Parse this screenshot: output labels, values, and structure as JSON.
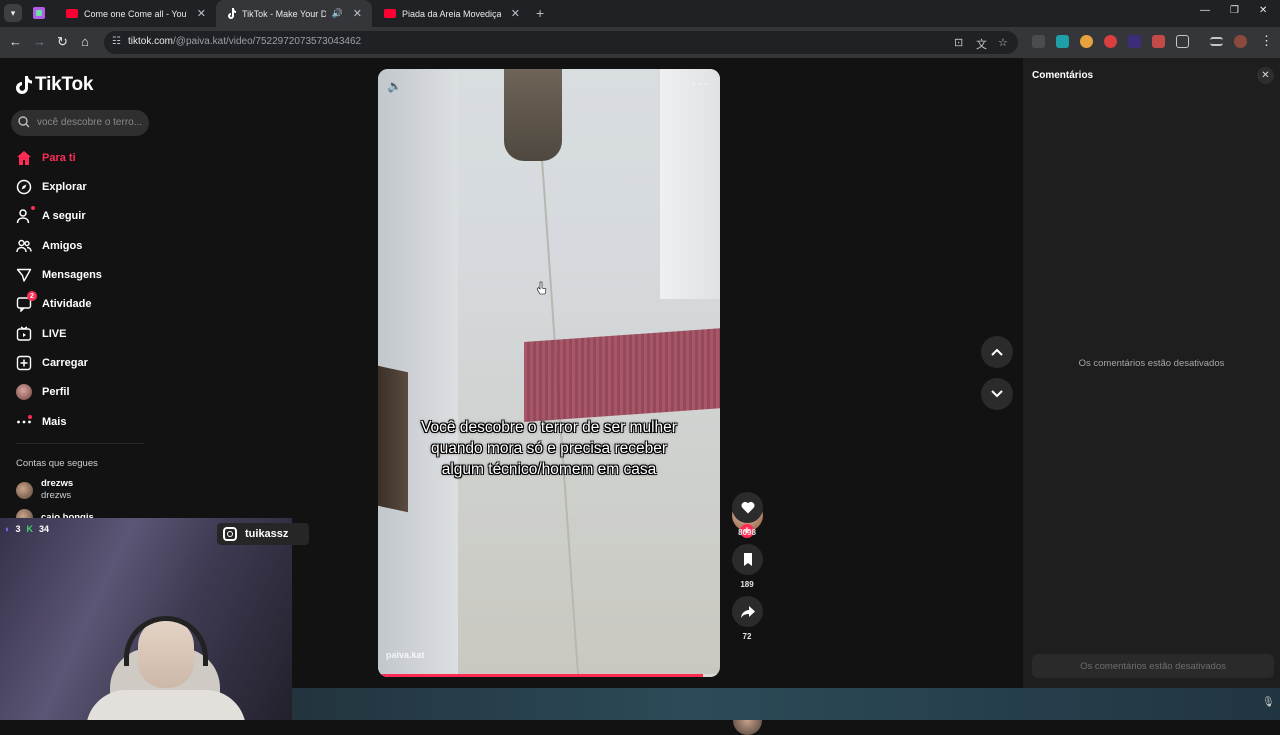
{
  "tabs": [
    {
      "title": "Come one Come all - YouTube",
      "favicon_color": "#ff0033",
      "active": false
    },
    {
      "title": "TikTok - Make Your Day",
      "favicon_color": "#ffffff",
      "active": true
    },
    {
      "title": "Piada da Areia Movediça! - You",
      "favicon_color": "#ff0033",
      "active": false
    }
  ],
  "address": {
    "domain": "tiktok.com",
    "path": "/@paiva.kat/video/7522972073573043462"
  },
  "app": {
    "logo": "TikTok",
    "search_placeholder": "você descobre o terro..."
  },
  "sidebar": {
    "items": [
      {
        "label": "Para ti",
        "icon": "home-icon",
        "active": true
      },
      {
        "label": "Explorar",
        "icon": "compass-icon"
      },
      {
        "label": "A seguir",
        "icon": "following-icon"
      },
      {
        "label": "Amigos",
        "icon": "friends-icon"
      },
      {
        "label": "Mensagens",
        "icon": "messages-icon"
      },
      {
        "label": "Atividade",
        "icon": "activity-icon",
        "badge": "2"
      },
      {
        "label": "LIVE",
        "icon": "live-icon"
      },
      {
        "label": "Carregar",
        "icon": "upload-icon"
      },
      {
        "label": "Perfil",
        "icon": "profile-avatar"
      },
      {
        "label": "Mais",
        "icon": "more-icon"
      }
    ],
    "following_title": "Contas que segues",
    "following": [
      {
        "name": "drezws",
        "handle": "drezws"
      },
      {
        "name": "caio.bongis",
        "handle": ""
      }
    ]
  },
  "video": {
    "caption": "Você descobre o terror de ser mulher quando mora só e precisa receber algum técnico/homem em casa",
    "author": "paiva.kat",
    "progress": 0.95
  },
  "actions": {
    "likes": "8698",
    "saves": "189",
    "shares": "72"
  },
  "comments": {
    "title": "Comentários",
    "disabled_text": "Os comentários estão desativados",
    "input_placeholder": "Os comentários estão desativados"
  },
  "overlay": {
    "stat1": "3",
    "stat2": "34",
    "instagram": "tuikassz"
  },
  "colors": {
    "accent": "#fe2c55",
    "background": "#121212",
    "panel": "#1e1e1e"
  }
}
